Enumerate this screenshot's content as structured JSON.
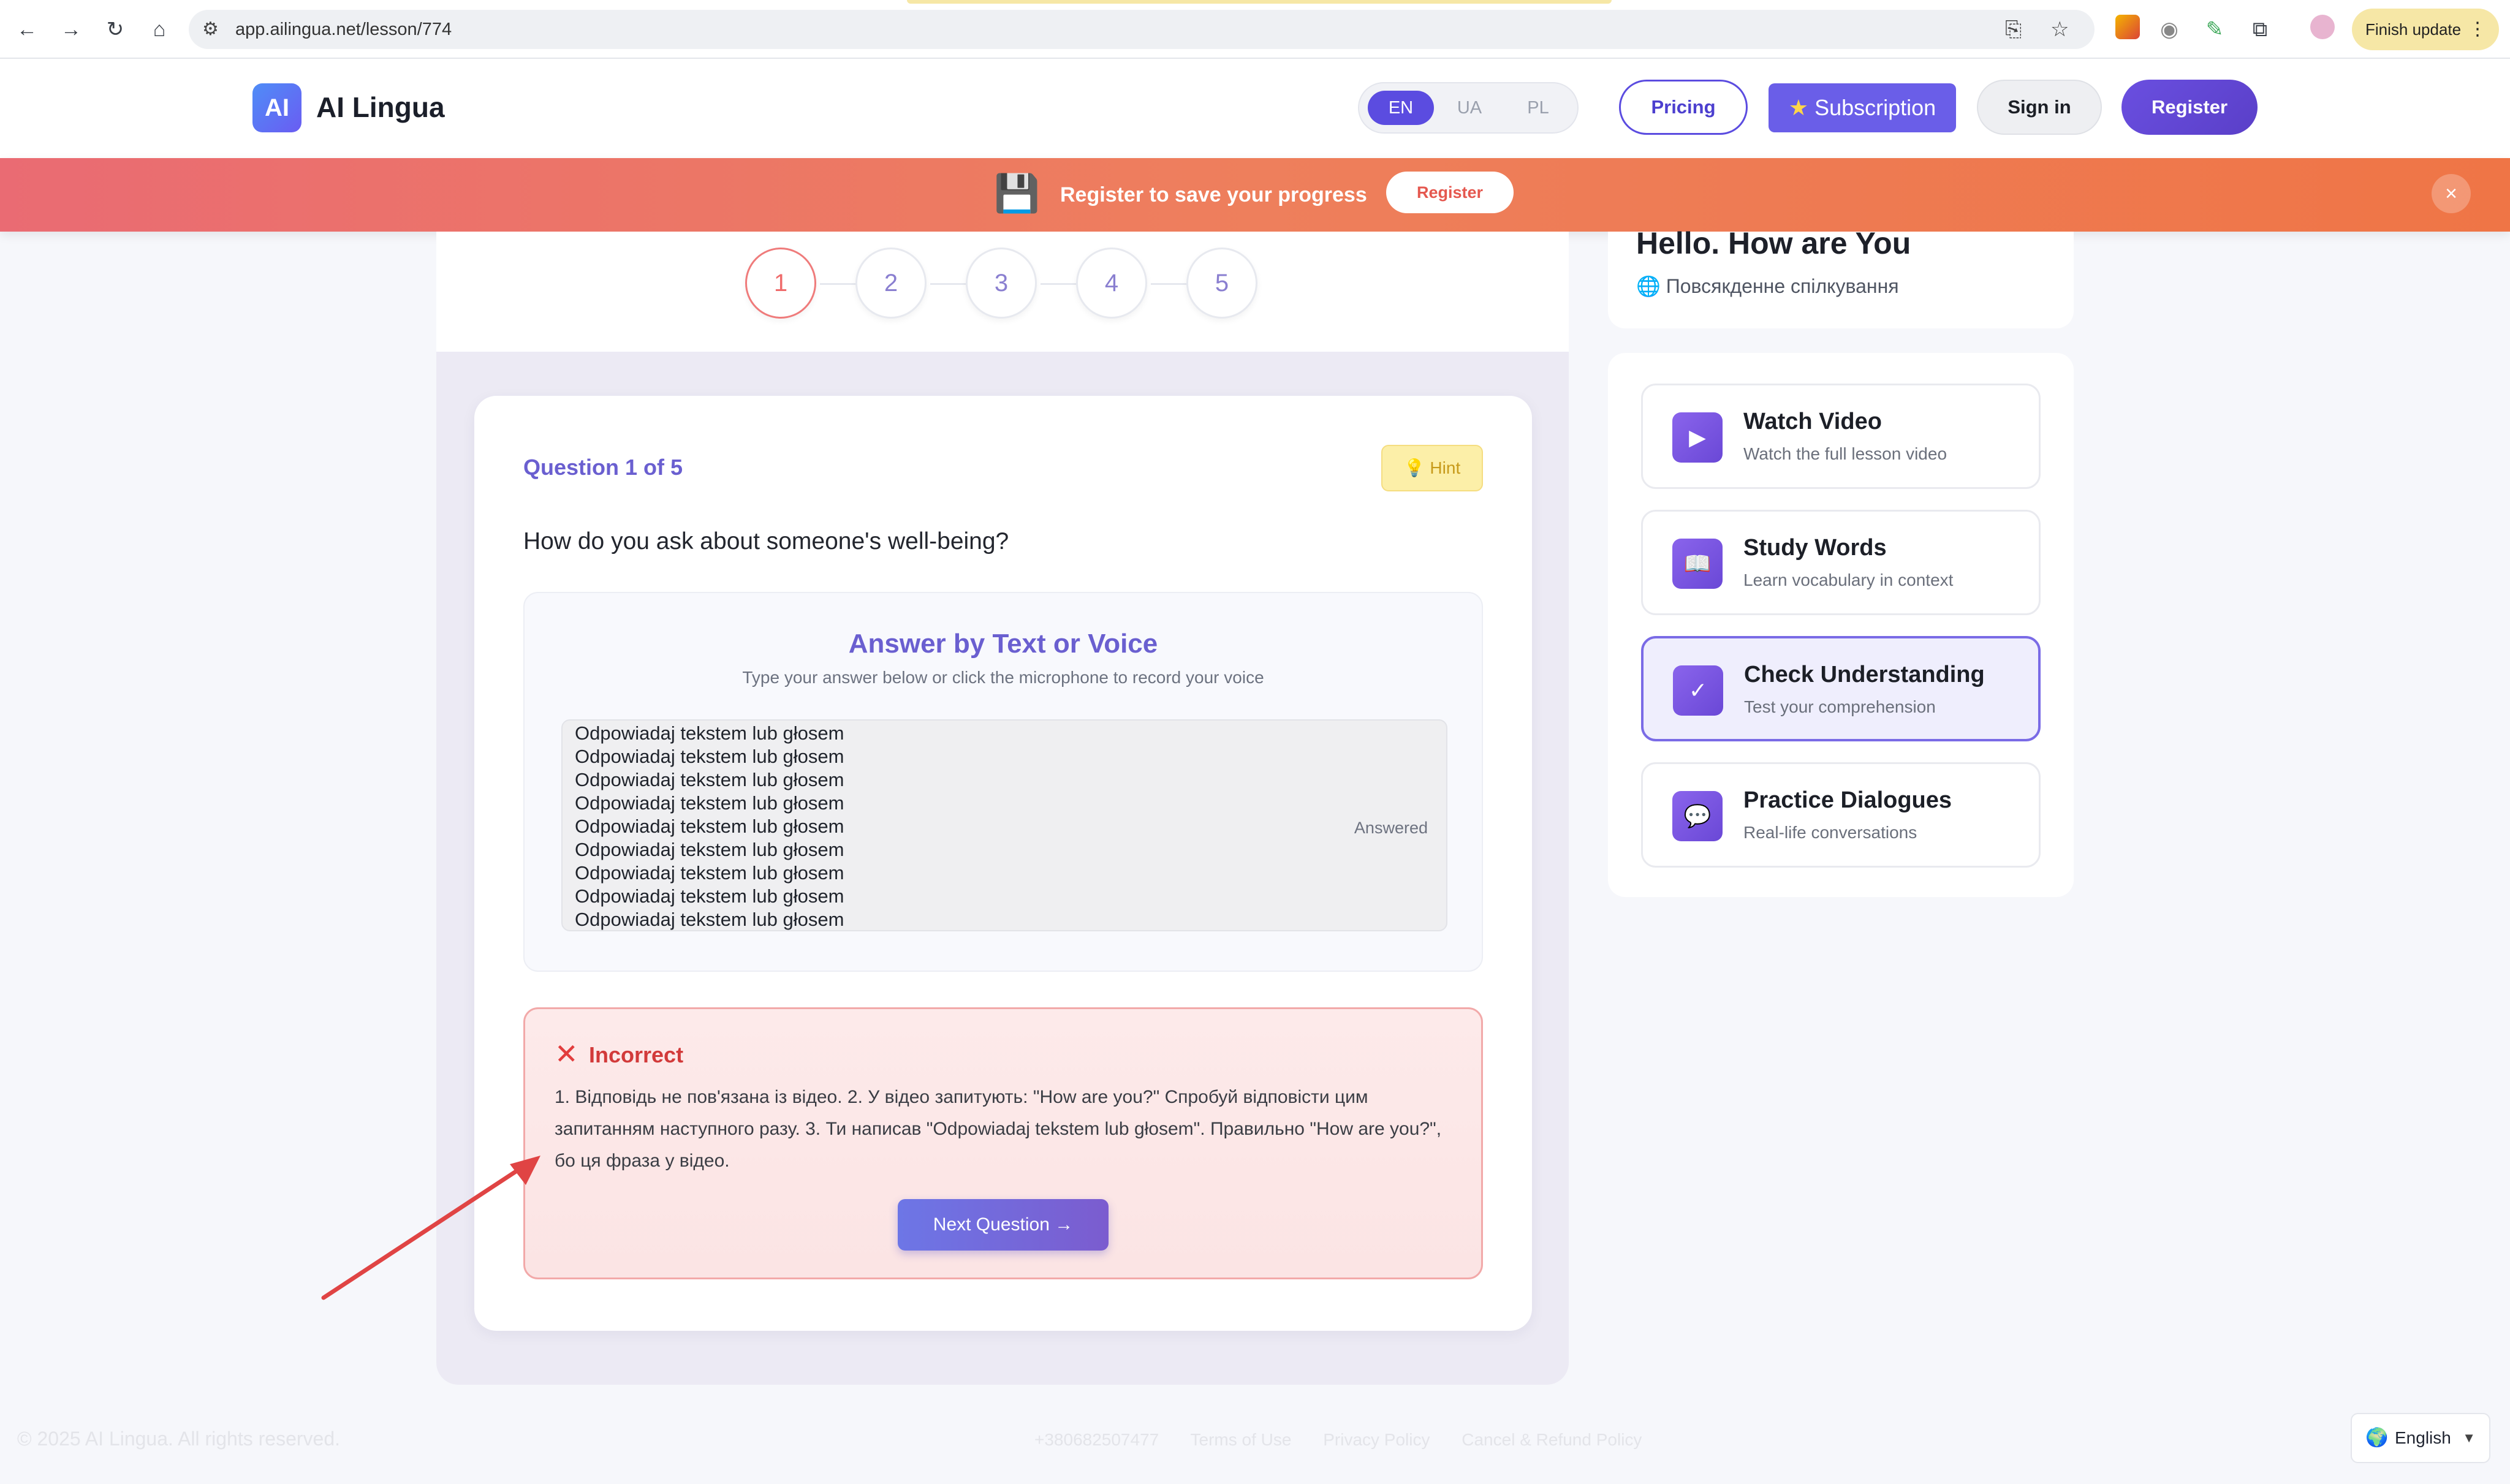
{
  "browser": {
    "url": "app.ailingua.net/lesson/774",
    "finish_update": "Finish update"
  },
  "header": {
    "logo_badge": "AI",
    "logo_text": "AI Lingua",
    "languages": [
      "EN",
      "UA",
      "PL"
    ],
    "active_language": "EN",
    "pricing": "Pricing",
    "subscription": "Subscription",
    "sign_in": "Sign in",
    "register": "Register"
  },
  "banner": {
    "message": "Register to save your progress",
    "button": "Register",
    "close": "×"
  },
  "steps": [
    "1",
    "2",
    "3",
    "4",
    "5"
  ],
  "quiz": {
    "counter": "Question 1 of 5",
    "hint": "💡 Hint",
    "question": "How do you ask about someone's well-being?",
    "answer_title": "Answer by Text or Voice",
    "answer_subtitle": "Type your answer below or click the microphone to record your voice",
    "answer_text": "Odpowiadaj tekstem lub głosem\nOdpowiadaj tekstem lub głosem\nOdpowiadaj tekstem lub głosem\nOdpowiadaj tekstem lub głosem\nOdpowiadaj tekstem lub głosem\nOdpowiadaj tekstem lub głosem\nOdpowiadaj tekstem lub głosem\nOdpowiadaj tekstem lub głosem\nOdpowiadaj tekstem lub głosem",
    "answered_tag": "Answered",
    "feedback_title": "Incorrect",
    "feedback_body": "1. Відповідь не пов'язана із відео. 2. У відео запитують: \"How are you?\" Спробуй відповісти цим запитанням наступного разу. 3. Ти написав \"Odpowiadaj tekstem lub głosem\". Правильно \"How are you?\", бо ця фраза у відео.",
    "next_button": "Next Question →"
  },
  "lesson": {
    "title": "Hello. How are You",
    "topic": "Повсякдення спілкування",
    "topic_full": "Повсякденне спілкування"
  },
  "nav_items": [
    {
      "title": "Watch Video",
      "desc": "Watch the full lesson video",
      "icon": "▶"
    },
    {
      "title": "Study Words",
      "desc": "Learn vocabulary in context",
      "icon": "📖"
    },
    {
      "title": "Check Understanding",
      "desc": "Test your comprehension",
      "icon": "✓"
    },
    {
      "title": "Practice Dialogues",
      "desc": "Real-life conversations",
      "icon": "💬"
    }
  ],
  "footer": {
    "copyright": "© 2025 AI Lingua. All rights reserved.",
    "phone": "+380682507477",
    "terms": "Terms of Use",
    "privacy": "Privacy Policy",
    "refund": "Cancel & Refund Policy",
    "language": "English"
  },
  "colors": {
    "accent": "#5b4ce0",
    "banner": "#ee7f5c",
    "error": "#e23d3d"
  }
}
